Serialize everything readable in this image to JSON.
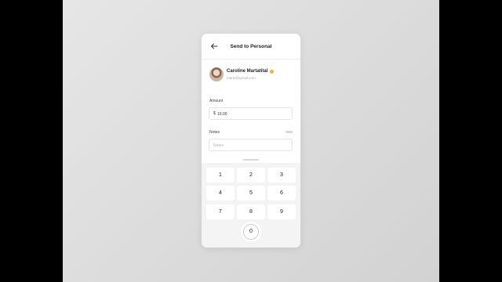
{
  "header": {
    "back_icon": "arrow-left-icon",
    "title": "Send to Personal"
  },
  "recipient": {
    "name": "Caroline Martatital",
    "email": "marta@gmail.com",
    "verified_color": "#f0b43a"
  },
  "amount": {
    "label": "Amount",
    "currency": "$",
    "value": "10.00"
  },
  "notes": {
    "label": "Notes",
    "counter": "0/50",
    "placeholder": "Notes"
  },
  "keypad": {
    "keys": [
      "1",
      "2",
      "3",
      "4",
      "5",
      "6",
      "7",
      "8",
      "9"
    ],
    "zero": "0"
  }
}
